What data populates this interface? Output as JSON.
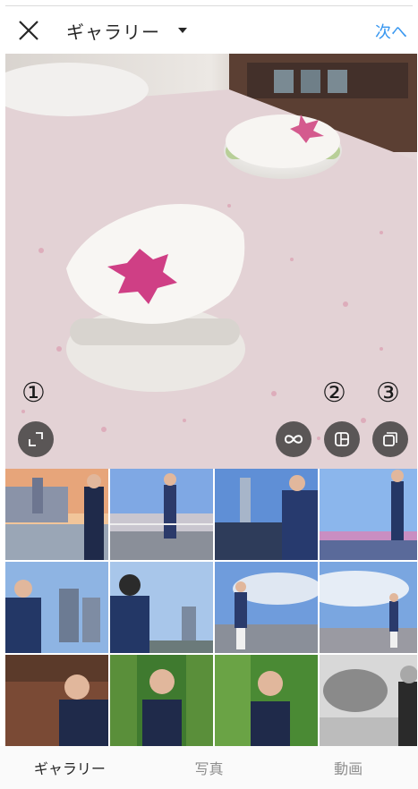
{
  "header": {
    "title": "ギャラリー",
    "next_label": "次へ"
  },
  "preview": {
    "annotations": [
      "①",
      "②",
      "③"
    ],
    "controls": [
      "expand-icon",
      "boomerang-icon",
      "layout-icon",
      "multi-select-icon"
    ]
  },
  "tabs": [
    {
      "label": "ギャラリー",
      "active": true
    },
    {
      "label": "写真",
      "active": false
    },
    {
      "label": "動画",
      "active": false
    }
  ],
  "colors": {
    "accent": "#3897f0",
    "control_bg": "#262626"
  }
}
